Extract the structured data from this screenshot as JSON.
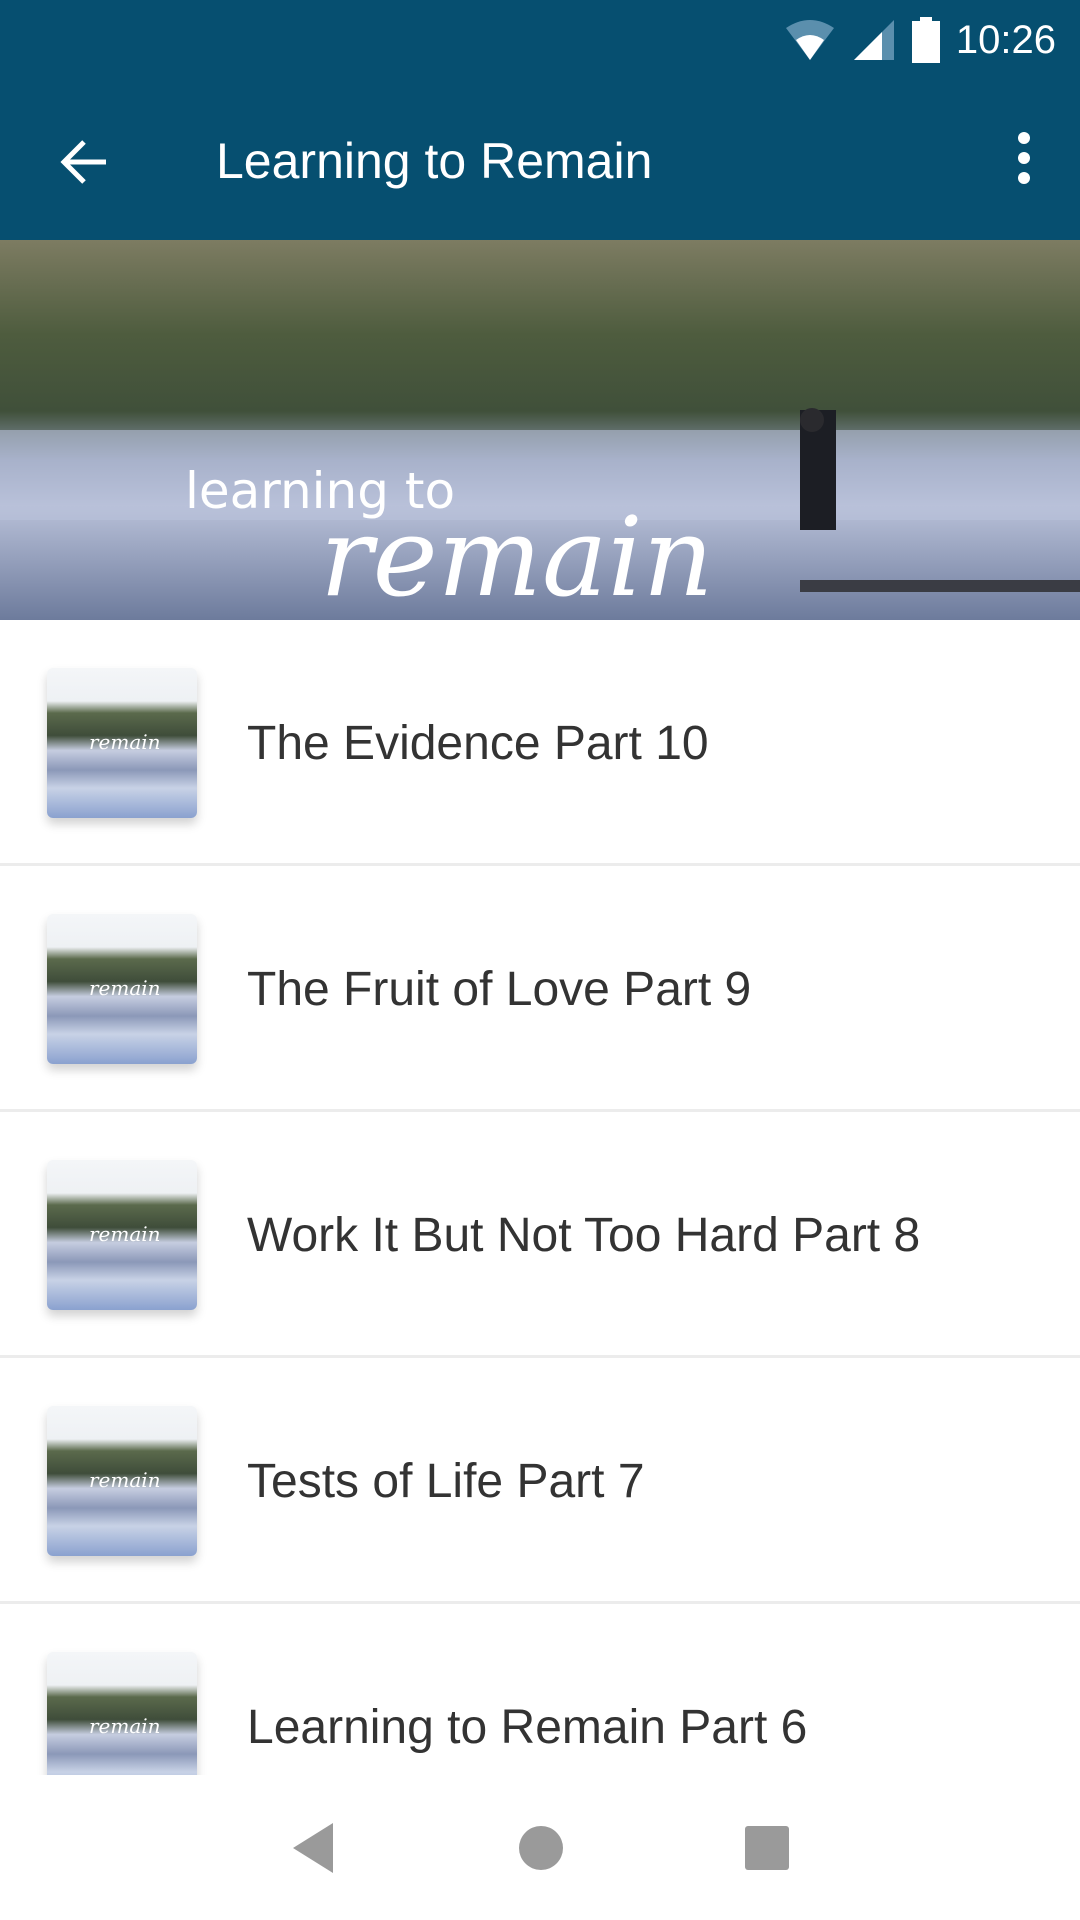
{
  "status_bar": {
    "time": "10:26",
    "icons": [
      "wifi-icon",
      "cell-signal-icon",
      "battery-icon"
    ]
  },
  "app_bar": {
    "title": "Learning to Remain",
    "back_icon": "arrow-left-icon",
    "menu_icon": "more-vert-icon"
  },
  "banner": {
    "logo_text_small": "learning to",
    "logo_text_large": "remain"
  },
  "list": {
    "items": [
      {
        "title": "The Evidence Part 10",
        "thumb_text": "remain"
      },
      {
        "title": "The Fruit of Love Part 9",
        "thumb_text": "remain"
      },
      {
        "title": "Work It But Not Too Hard Part 8",
        "thumb_text": "remain"
      },
      {
        "title": "Tests of Life Part 7",
        "thumb_text": "remain"
      },
      {
        "title": "Learning to Remain Part 6",
        "thumb_text": "remain"
      }
    ]
  },
  "colors": {
    "app_bar": "#064f70",
    "text": "#333333"
  }
}
